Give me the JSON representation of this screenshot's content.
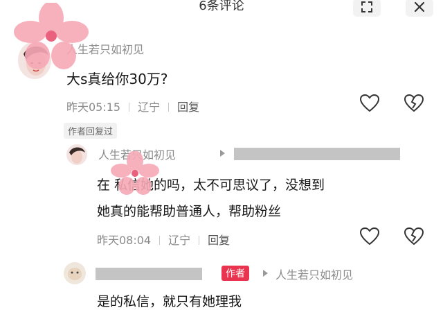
{
  "header": {
    "title": "6条评论",
    "expand_icon": "expand-icon",
    "close_icon": "close-icon"
  },
  "comments": [
    {
      "nickname": "人生若只如初见",
      "text": "大s真给你30万?",
      "time": "昨天05:15",
      "location": "辽宁",
      "reply_label": "回复"
    },
    {
      "badge": "作者回复过"
    },
    {
      "nickname": "人生若只如初见",
      "reply_to_hidden": true,
      "line1": "在      私信她的吗，太不可思议了，没想到",
      "line2": "她真的能帮助普通人，帮助粉丝",
      "time": "昨天08:04",
      "location": "辽宁",
      "reply_label": "回复"
    },
    {
      "author_badge": "作者",
      "reply_to": "人生若只如初见",
      "text": "是的私信，就只有她理我"
    }
  ],
  "colors": {
    "author_badge": "#e8344e",
    "flower": "#f6a9b6",
    "flower_center": "#e8516f",
    "redaction": "#c4c4c4"
  }
}
